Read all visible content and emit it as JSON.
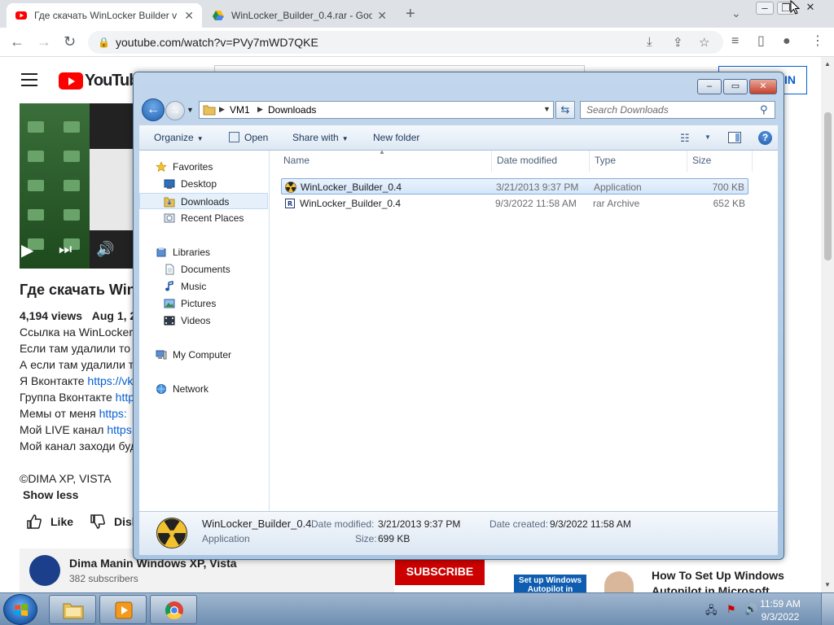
{
  "browser": {
    "tabs": [
      {
        "title": "Где скачать WinLocker Builder v",
        "close": "✕"
      },
      {
        "title": "WinLocker_Builder_0.4.rar - Goog",
        "close": "✕"
      }
    ],
    "new_tab": "+",
    "url": "youtube.com/watch?v=PVy7mWD7QKE"
  },
  "youtube": {
    "logo_text": "YouTube",
    "sign_in": "IN",
    "video_title": "Где скачать Win",
    "views": "4,194 views",
    "date": "Aug 1, 20",
    "description": [
      {
        "text": "Ссылка на WinLocker",
        "link": ""
      },
      {
        "text": "Если там удалили то",
        "link": ""
      },
      {
        "text": "А если там удалили т",
        "link": ""
      },
      {
        "text": "Я Вконтакте ",
        "link": "https://vk"
      },
      {
        "text": "Группа Вконтакте ",
        "link": "http"
      },
      {
        "text": "Мемы от меня  ",
        "link": "https:"
      },
      {
        "text": "Мой LIVE канал ",
        "link": "https"
      },
      {
        "text": "Мой канал заходи буд",
        "link": ""
      }
    ],
    "copyright": "©DIMA XP, VISTA",
    "show_less": "Show less",
    "like": "Like",
    "dislike": "Disl",
    "channel_name": "Dima Manin Windows XP, Vista",
    "subscribers": "382 subscribers",
    "subscribe": "SUBSCRIBE",
    "related_thumb": "Set up Windows Autopilot in",
    "related_title": "How To Set Up Windows Autopilot in Microsoft"
  },
  "explorer": {
    "window_buttons": {
      "minimize": "–",
      "maximize": "▭",
      "close": "✕"
    },
    "breadcrumb": [
      "VM1",
      "Downloads"
    ],
    "search_placeholder": "Search Downloads",
    "commands": {
      "organize": "Organize",
      "open": "Open",
      "share_with": "Share with",
      "new_folder": "New folder"
    },
    "nav": {
      "favorites": "Favorites",
      "desktop": "Desktop",
      "downloads": "Downloads",
      "recent_places": "Recent Places",
      "libraries": "Libraries",
      "documents": "Documents",
      "music": "Music",
      "pictures": "Pictures",
      "videos": "Videos",
      "my_computer": "My Computer",
      "network": "Network"
    },
    "columns": {
      "name": "Name",
      "date_modified": "Date modified",
      "type": "Type",
      "size": "Size"
    },
    "files": [
      {
        "name": "WinLocker_Builder_0.4",
        "date": "3/21/2013 9:37 PM",
        "type": "Application",
        "size": "700 KB"
      },
      {
        "name": "WinLocker_Builder_0.4",
        "date": "9/3/2022 11:58 AM",
        "type": "rar Archive",
        "size": "652 KB"
      }
    ],
    "details": {
      "name": "WinLocker_Builder_0.4",
      "kind": "Application",
      "date_modified_label": "Date modified:",
      "date_modified": "3/21/2013 9:37 PM",
      "date_created_label": "Date created:",
      "date_created": "9/3/2022 11:58 AM",
      "size_label": "Size:",
      "size": "699 KB"
    }
  },
  "taskbar": {
    "time": "11:59 AM",
    "date": "9/3/2022"
  },
  "colors": {
    "yt_red": "#ff0000",
    "link_blue": "#065fd4",
    "selection": "#d3e6fb"
  }
}
